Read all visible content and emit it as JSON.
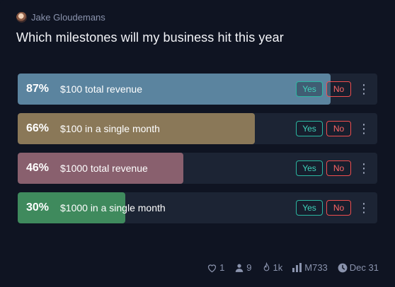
{
  "author": {
    "name": "Jake Gloudemans"
  },
  "question": "Which milestones will my business hit this year",
  "options": [
    {
      "percent": "87%",
      "value": 0.87,
      "label": "$100 total revenue",
      "color": "#5b849f"
    },
    {
      "percent": "66%",
      "value": 0.66,
      "label": "$100 in a single month",
      "color": "#8a7858"
    },
    {
      "percent": "46%",
      "value": 0.46,
      "label": "$1000 total revenue",
      "color": "#89606e"
    },
    {
      "percent": "30%",
      "value": 0.3,
      "label": "$1000 in a single month",
      "color": "#3f8a5d"
    }
  ],
  "buttons": {
    "yes": "Yes",
    "no": "No",
    "more": "⋮"
  },
  "footer": {
    "likes": "1",
    "traders": "9",
    "views": "1k",
    "volume": "M733",
    "close_date": "Dec 31"
  },
  "colors": {
    "background": "#0f1422",
    "track": "#1c2434",
    "yes_accent": "#2bb7a1",
    "no_accent": "#ef4e4e"
  },
  "icons": {
    "likes": "heart-icon",
    "traders": "user-icon",
    "views": "flame-icon",
    "volume": "bar-chart-icon",
    "close_date": "clock-icon"
  }
}
